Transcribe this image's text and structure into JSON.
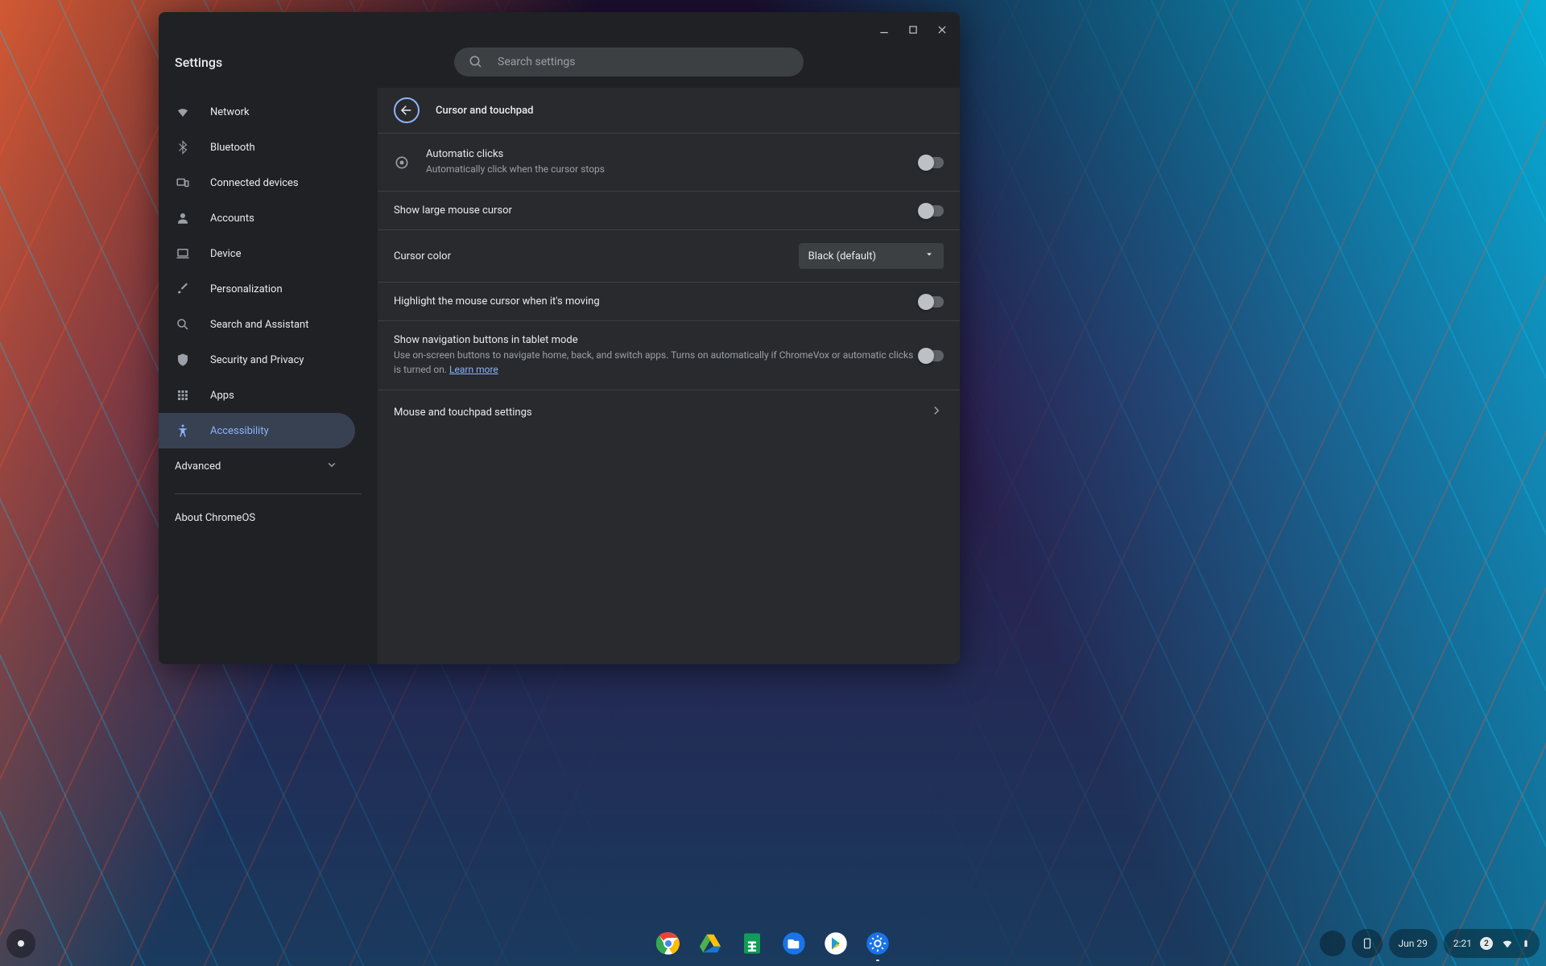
{
  "app_title": "Settings",
  "search": {
    "placeholder": "Search settings"
  },
  "sidebar": {
    "items": [
      {
        "label": "Network"
      },
      {
        "label": "Bluetooth"
      },
      {
        "label": "Connected devices"
      },
      {
        "label": "Accounts"
      },
      {
        "label": "Device"
      },
      {
        "label": "Personalization"
      },
      {
        "label": "Search and Assistant"
      },
      {
        "label": "Security and Privacy"
      },
      {
        "label": "Apps"
      },
      {
        "label": "Accessibility"
      }
    ],
    "advanced": "Advanced",
    "about": "About ChromeOS"
  },
  "page": {
    "title": "Cursor and touchpad",
    "rows": {
      "autoclick": {
        "title": "Automatic clicks",
        "sub": "Automatically click when the cursor stops"
      },
      "large_cursor": {
        "title": "Show large mouse cursor"
      },
      "cursor_color": {
        "title": "Cursor color",
        "value": "Black (default)"
      },
      "highlight": {
        "title": "Highlight the mouse cursor when it's moving"
      },
      "nav_buttons": {
        "title": "Show navigation buttons in tablet mode",
        "sub": "Use on-screen buttons to navigate home, back, and switch apps. Turns on automatically if ChromeVox or automatic clicks is turned on. ",
        "learn": "Learn more"
      },
      "mouse_touchpad": {
        "title": "Mouse and touchpad settings"
      }
    }
  },
  "shelf": {
    "date": "Jun 29",
    "time": "2:21",
    "notif_count": "2"
  }
}
